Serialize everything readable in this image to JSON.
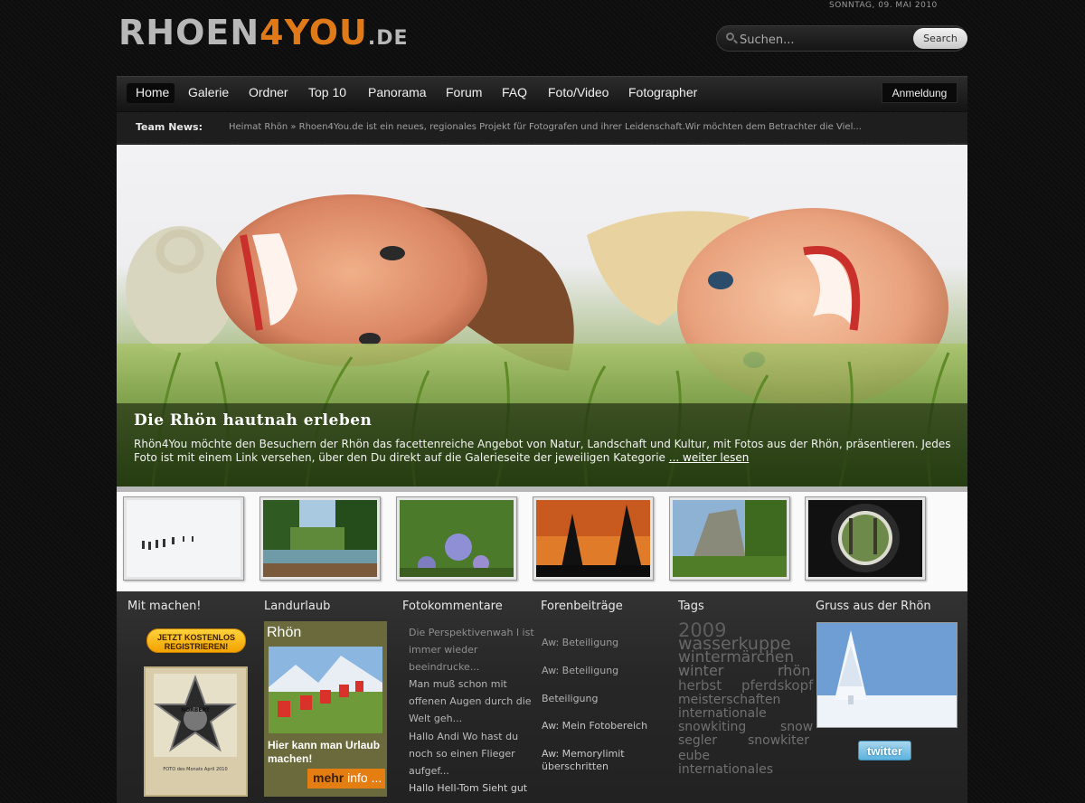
{
  "header": {
    "logo": {
      "part1": "RHOEN",
      "part2": "4YOU",
      "part3": ".DE"
    },
    "date": "SONNTAG, 09. MAI 2010",
    "search": {
      "placeholder": "Suchen...",
      "button": "Search"
    }
  },
  "nav": {
    "items": [
      {
        "label": "Home",
        "active": true
      },
      {
        "label": "Galerie"
      },
      {
        "label": "Ordner"
      },
      {
        "label": "Top 10"
      },
      {
        "label": "Panorama"
      },
      {
        "label": "Forum"
      },
      {
        "label": "FAQ"
      },
      {
        "label": "Foto/Video"
      },
      {
        "label": "Fotographer"
      }
    ],
    "login": "Anmeldung"
  },
  "news": {
    "label": "Team News:",
    "text": "Heimat Rhön » Rhoen4You.de ist ein neues, regionales Projekt für Fotografen und ihrer Leidenschaft.Wir möchten dem Betrachter die Viel..."
  },
  "hero": {
    "title": "Die Rhön hautnah erleben",
    "text": "Rhön4You möchte den Besuchern der Rhön das facettenreiche Angebot von Natur, Landschaft und Kultur, mit Fotos aus der Rhön, präsentieren. Jedes Foto ist mit einem Link versehen, über den Du direkt auf die Galerieseite der jeweiligen Kategorie",
    "more": "... weiter lesen"
  },
  "thumbnails": [
    {
      "subject": "snow-hikers"
    },
    {
      "subject": "forest-lake"
    },
    {
      "subject": "thistle-flower"
    },
    {
      "subject": "sunset-trees"
    },
    {
      "subject": "rock-cliff"
    },
    {
      "subject": "tunnel-view"
    }
  ],
  "columns": {
    "mitmachen": {
      "title": "Mit machen!",
      "signup_line1": "JETZT KOSTENLOS",
      "signup_line2": "REGISTRIEREN!",
      "award_name": "NORBERT",
      "award_caption": "FOTO des Monats April 2010"
    },
    "landurlaub": {
      "title": "Landurlaub",
      "box_title": "Rhön",
      "text": "Hier kann man Urlaub machen!",
      "more_a": "mehr",
      "more_b": " info ..."
    },
    "fotokommentare": {
      "title": "Fotokommentare",
      "items": [
        "Die Perspektivenwah l ist immer wieder beeindrucke...",
        "Man muß schon mit offenen Augen durch die Welt geh...",
        "Hallo Andi Wo hast du noch so einen Flieger aufgef...",
        "Hallo Hell-Tom Sieht gut"
      ]
    },
    "forenbeitraege": {
      "title": "Forenbeiträge",
      "items": [
        "Aw: Beteiligung",
        "Aw: Beteiligung",
        "Beteiligung",
        "Aw: Mein Fotobereich",
        "Aw: Memorylimit überschritten"
      ]
    },
    "tags": {
      "title": "Tags",
      "items": [
        "2009",
        "wasserkuppe",
        "wintermärchen",
        "winter",
        "rhön",
        "herbst",
        "pferdskopf",
        "meisterschaften",
        "internationale",
        "snowkiting",
        "snow",
        "segler",
        "snowkiter",
        "eube",
        "internationales"
      ]
    },
    "gruss": {
      "title": "Gruss aus der Rhön",
      "twitter": "twitter"
    }
  },
  "colors": {
    "accent": "#e07a18",
    "background": "#0d0d0d",
    "nav": "#1f1f1f"
  }
}
